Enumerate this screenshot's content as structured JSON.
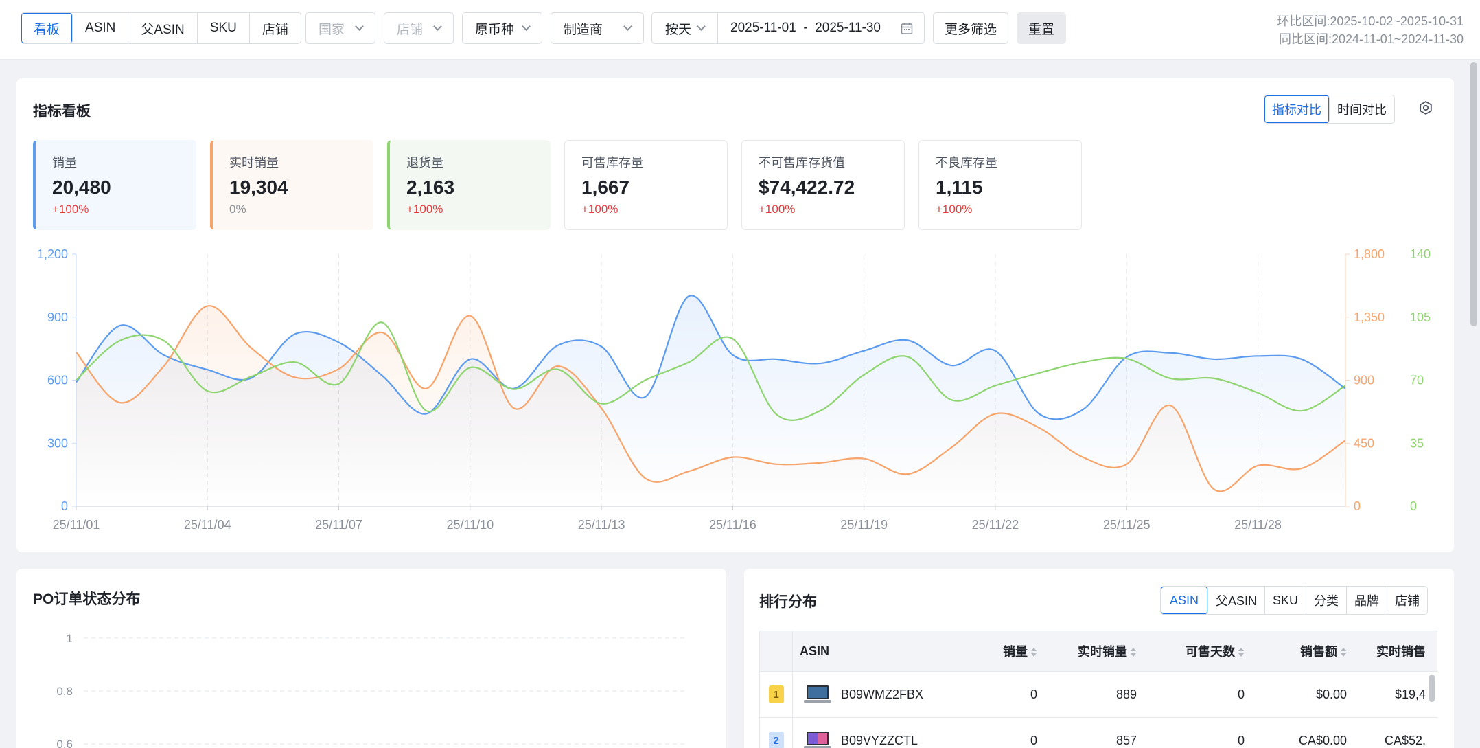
{
  "filters": {
    "view_tabs": [
      "看板",
      "ASIN",
      "父ASIN",
      "SKU",
      "店铺"
    ],
    "country_placeholder": "国家",
    "store_placeholder": "店铺",
    "currency": "原币种",
    "manufacturer": "制造商",
    "granularity": "按天",
    "date_range": "2025-11-01  -  2025-11-30",
    "more_filters": "更多筛选",
    "reset": "重置",
    "mom_range": "环比区间:2025-10-02~2025-10-31",
    "yoy_range": "同比区间:2024-11-01~2024-11-30"
  },
  "dashboard": {
    "title": "指标看板",
    "compare_tabs": [
      "指标对比",
      "时间对比"
    ],
    "metrics": [
      {
        "label": "销量",
        "value": "20,480",
        "change": "+100%"
      },
      {
        "label": "实时销量",
        "value": "19,304",
        "change": "0%"
      },
      {
        "label": "退货量",
        "value": "2,163",
        "change": "+100%"
      },
      {
        "label": "可售库存量",
        "value": "1,667",
        "change": "+100%"
      },
      {
        "label": "不可售库存货值",
        "value": "$74,422.72",
        "change": "+100%"
      },
      {
        "label": "不良库存量",
        "value": "1,115",
        "change": "+100%"
      }
    ]
  },
  "colors": {
    "blue": "#5b9bef",
    "orange": "#f7a46b",
    "green": "#8ed46f",
    "accent": "#1f6fe5",
    "red": "#e83a3a"
  },
  "chart_data": {
    "type": "line",
    "x": [
      "25/11/01",
      "25/11/02",
      "25/11/03",
      "25/11/04",
      "25/11/05",
      "25/11/06",
      "25/11/07",
      "25/11/08",
      "25/11/09",
      "25/11/10",
      "25/11/11",
      "25/11/12",
      "25/11/13",
      "25/11/14",
      "25/11/15",
      "25/11/16",
      "25/11/17",
      "25/11/18",
      "25/11/19",
      "25/11/20",
      "25/11/21",
      "25/11/22",
      "25/11/23",
      "25/11/24",
      "25/11/25",
      "25/11/26",
      "25/11/27",
      "25/11/28",
      "25/11/29",
      "25/11/30"
    ],
    "x_tick_labels": [
      "25/11/01",
      "25/11/04",
      "25/11/07",
      "25/11/10",
      "25/11/13",
      "25/11/16",
      "25/11/19",
      "25/11/22",
      "25/11/25",
      "25/11/28"
    ],
    "y_left_ticks": [
      0,
      300,
      600,
      900,
      1200
    ],
    "y_right1_ticks": [
      0,
      450,
      900,
      1350,
      1800
    ],
    "y_right2_ticks": [
      0,
      35,
      70,
      105,
      140
    ],
    "ylim_left": [
      0,
      1200
    ],
    "ylim_right1": [
      0,
      1800
    ],
    "ylim_right2": [
      0,
      140
    ],
    "grid": "vertical dashed",
    "series": [
      {
        "axis": "left",
        "color": "#5b9bef",
        "area": true,
        "values": [
          590,
          860,
          720,
          650,
          610,
          820,
          780,
          620,
          440,
          700,
          560,
          765,
          760,
          520,
          1000,
          720,
          700,
          680,
          740,
          790,
          670,
          740,
          440,
          460,
          710,
          730,
          700,
          715,
          700,
          560
        ]
      },
      {
        "axis": "right1",
        "color": "#f7a46b",
        "area": true,
        "values": [
          1100,
          740,
          1000,
          1430,
          1130,
          920,
          980,
          1240,
          840,
          1360,
          700,
          1000,
          700,
          200,
          250,
          350,
          300,
          310,
          340,
          230,
          420,
          660,
          560,
          350,
          300,
          720,
          120,
          290,
          270,
          470
        ]
      },
      {
        "axis": "right2",
        "color": "#8ed46f",
        "area": false,
        "values": [
          70,
          92,
          92,
          64,
          72,
          80,
          68,
          102,
          53,
          77,
          65,
          76,
          57,
          70,
          80,
          93,
          51,
          53,
          73,
          83,
          59,
          67,
          74,
          80,
          82,
          71,
          71,
          63,
          53,
          67
        ]
      }
    ]
  },
  "po_status": {
    "title": "PO订单状态分布",
    "y_ticks": [
      "1",
      "0.8",
      "0.6"
    ]
  },
  "ranking": {
    "title": "排行分布",
    "tabs": [
      "ASIN",
      "父ASIN",
      "SKU",
      "分类",
      "品牌",
      "店铺"
    ],
    "columns": [
      "ASIN",
      "销量",
      "实时销量",
      "可售天数",
      "销售额",
      "实时销售"
    ],
    "rows": [
      {
        "rank": "1",
        "asin": "B09WMZ2FBX",
        "sales": "0",
        "realtime_sales": "889",
        "days": "0",
        "revenue": "$0.00",
        "realtime_revenue": "$19,4"
      },
      {
        "rank": "2",
        "asin": "B09VYZZCTL",
        "sales": "0",
        "realtime_sales": "857",
        "days": "0",
        "revenue": "CA$0.00",
        "realtime_revenue": "CA$52,"
      }
    ]
  }
}
